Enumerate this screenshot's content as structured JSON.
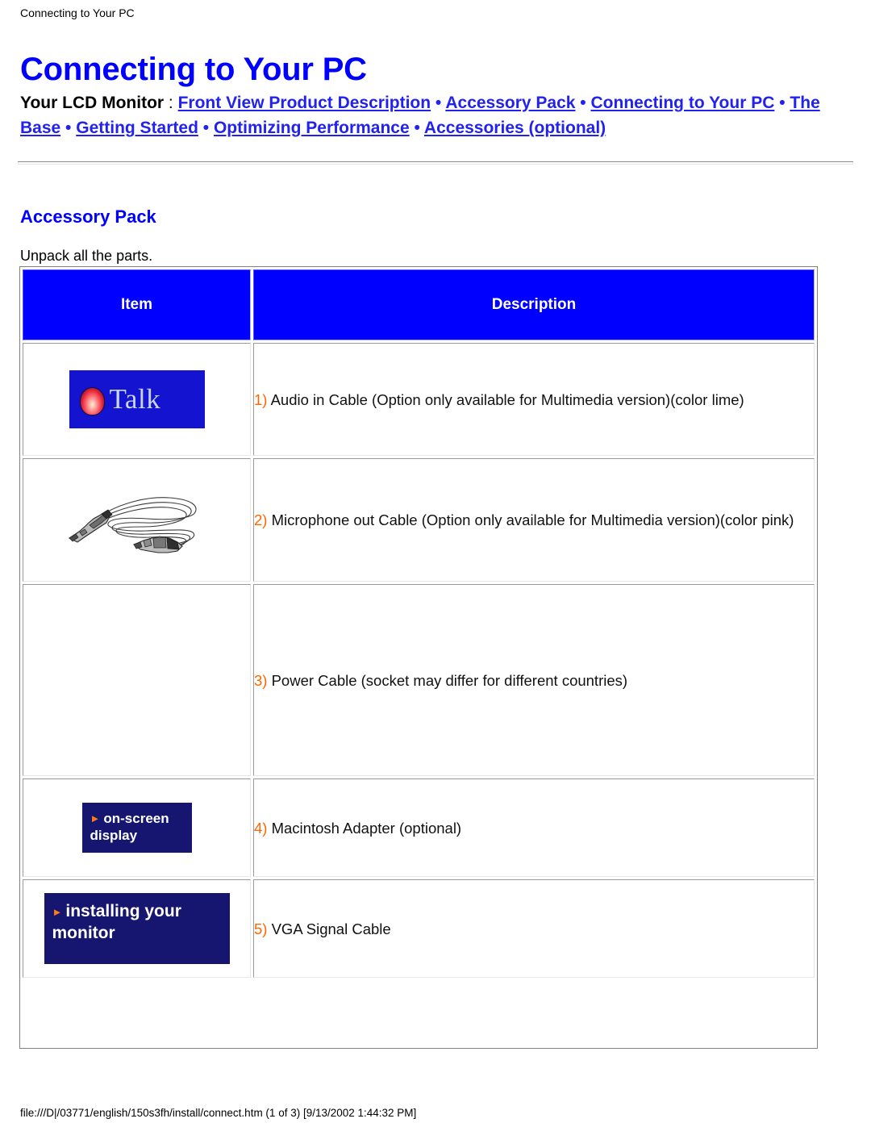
{
  "breadcrumb": "Connecting to Your PC",
  "page_title": "Connecting to Your PC",
  "nav": {
    "lead": "Your LCD Monitor",
    "colon": " : ",
    "separator": " • ",
    "links": [
      "Front View Product Description",
      "Accessory Pack",
      "Connecting to Your PC",
      "The Base",
      "Getting Started",
      "Optimizing Performance",
      "Accessories (optional)"
    ]
  },
  "section": {
    "heading": "Accessory Pack",
    "intro": "Unpack all the parts."
  },
  "table": {
    "headers": [
      "Item",
      "Description"
    ],
    "rows": [
      {
        "num": "1)",
        "description": " Audio in Cable (Option only available for Multimedia version)(color lime)",
        "thumb": "talk-banner-image",
        "thumb_text": "Talk"
      },
      {
        "num": "2)",
        "description": " Microphone out Cable (Option only available for Multimedia version)(color pink)",
        "thumb": "audio-cable-image",
        "thumb_text": ""
      },
      {
        "num": "3)",
        "description": " Power Cable (socket may differ for different countries)",
        "thumb": "missing-image",
        "thumb_text": ""
      },
      {
        "num": "4)",
        "description": " Macintosh Adapter (optional)",
        "thumb": "on-screen-display-banner",
        "thumb_text": "on-screen display"
      },
      {
        "num": "5)",
        "description": " VGA Signal Cable",
        "thumb": "installing-your-monitor-banner",
        "thumb_text": "installing your monitor"
      }
    ]
  },
  "colors": {
    "link": "#2222ee",
    "heading": "#0000ff",
    "header_bg": "#0000ff",
    "number": "#ff6600",
    "banner_bg": "#161670",
    "banner_arrow": "#ff7a18"
  },
  "footer": "file:///D|/03771/english/150s3fh/install/connect.htm (1 of 3) [9/13/2002 1:44:32 PM]"
}
